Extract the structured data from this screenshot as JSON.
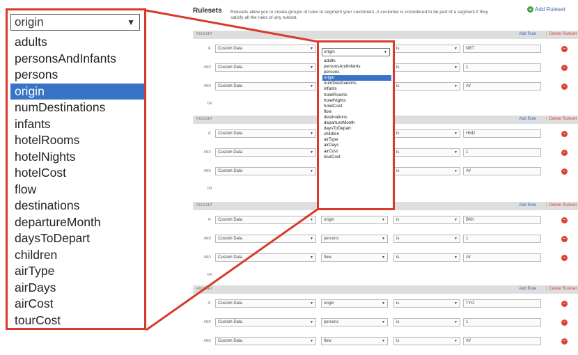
{
  "header": {
    "title": "Rulesets",
    "description": "Rulesets allow you to create groups of rules to segment your customers. A customer is considered to be part of a segment if they satisfy all the rules of any ruleset.",
    "add_ruleset": "Add Ruleset"
  },
  "dropdown": {
    "selected": "origin",
    "options": [
      "adults",
      "personsAndInfants",
      "persons",
      "origin",
      "numDestinations",
      "infants",
      "hotelRooms",
      "hotelNights",
      "hotelCost",
      "flow",
      "destinations",
      "departureMonth",
      "daysToDepart",
      "children",
      "airType",
      "airDays",
      "airCost",
      "tourCost"
    ],
    "selected_index": 3
  },
  "rulesets": [
    {
      "label": "RULESET",
      "add_rule": "Add Rule",
      "delete": "Delete Ruleset",
      "rules": [
        {
          "conj": "IF",
          "source": "Custom Data",
          "variable": "origin",
          "operator": "is",
          "value": "NBT"
        },
        {
          "conj": "AND",
          "source": "Custom Data",
          "variable": "",
          "operator": "is",
          "value": "1"
        },
        {
          "conj": "AND",
          "source": "Custom Data",
          "variable": "",
          "operator": "is",
          "value": "AY"
        }
      ],
      "or": "OR"
    },
    {
      "label": "RULESET",
      "add_rule": "Add Rule",
      "delete": "Delete Ruleset",
      "rules": [
        {
          "conj": "IF",
          "source": "Custom Data",
          "variable": "",
          "operator": "is",
          "value": "HND"
        },
        {
          "conj": "AND",
          "source": "Custom Data",
          "variable": "",
          "operator": "is",
          "value": "1"
        },
        {
          "conj": "AND",
          "source": "Custom Data",
          "variable": "",
          "operator": "is",
          "value": "AY"
        }
      ],
      "or": "OR"
    },
    {
      "label": "RULESET",
      "add_rule": "Add Rule",
      "delete": "Delete Ruleset",
      "rules": [
        {
          "conj": "IF",
          "source": "Custom Data",
          "variable": "origin",
          "operator": "is",
          "value": "BKK"
        },
        {
          "conj": "AND",
          "source": "Custom Data",
          "variable": "persons",
          "operator": "is",
          "value": "1"
        },
        {
          "conj": "AND",
          "source": "Custom Data",
          "variable": "flow",
          "operator": "is",
          "value": "AY"
        }
      ],
      "or": "OR"
    },
    {
      "label": "RULESET",
      "add_rule": "Add Rule",
      "delete": "Delete Ruleset",
      "rules": [
        {
          "conj": "IF",
          "source": "Custom Data",
          "variable": "origin",
          "operator": "is",
          "value": "TYO"
        },
        {
          "conj": "AND",
          "source": "Custom Data",
          "variable": "persons",
          "operator": "is",
          "value": "1"
        },
        {
          "conj": "AND",
          "source": "Custom Data",
          "variable": "flow",
          "operator": "is",
          "value": "AY"
        }
      ],
      "or": ""
    }
  ],
  "icons": {
    "dropdown_arrow": "triangle-down-icon",
    "remove": "remove-circle-icon",
    "add": "add-circle-icon"
  },
  "colors": {
    "callout": "#d93a2b",
    "selection": "#3874c5",
    "link": "#3a6db0",
    "remove": "#e04030",
    "add": "#3aa845"
  }
}
